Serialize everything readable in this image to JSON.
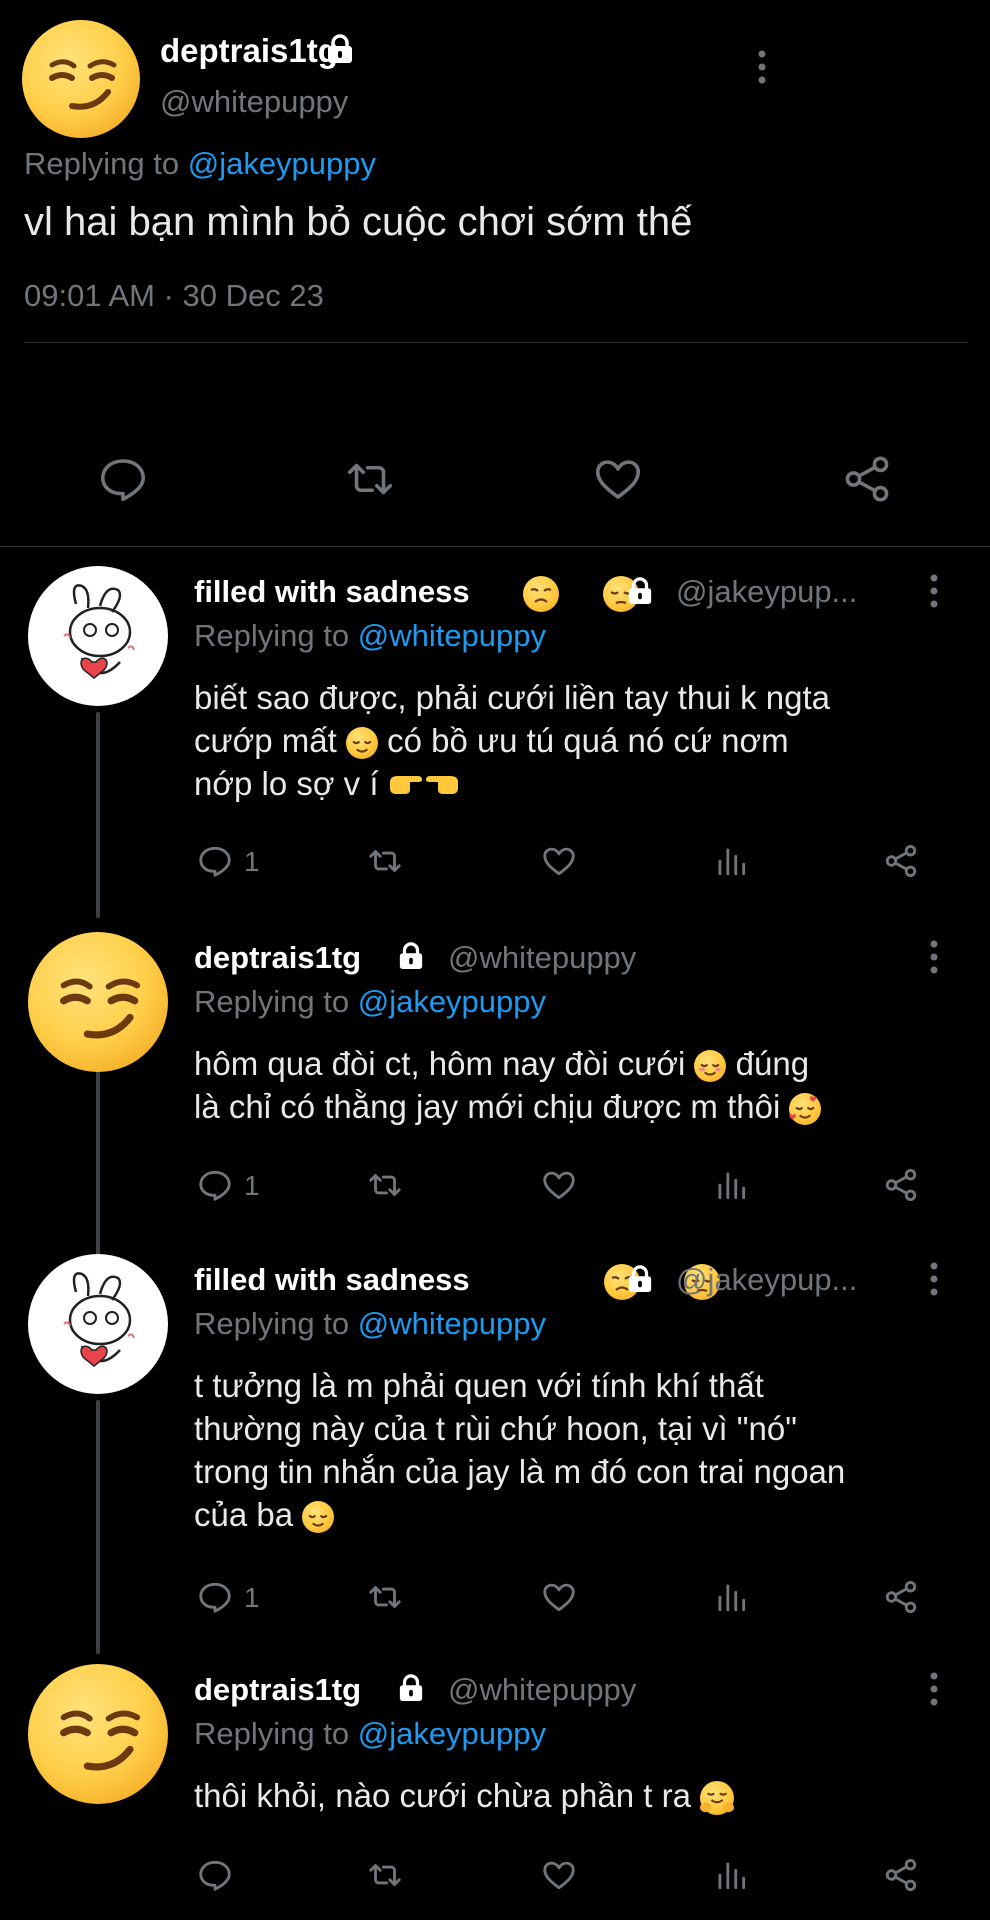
{
  "main_tweet": {
    "display_name": "deptrais1tg",
    "handle": "@whitepuppy",
    "replying_prefix": "Replying to ",
    "replying_to": "@jakeypuppy",
    "text": "vl hai bạn mình bỏ cuộc chơi sớm thế",
    "timestamp": "09:01 AM · 30 Dec 23"
  },
  "replies": [
    {
      "display_name": "filled with sadness",
      "handle": "@jakeypup...",
      "replying_prefix": "Replying to ",
      "replying_to": "@whitepuppy",
      "lines": [
        "biết sao được, phải cưới liền tay thui k ngta",
        "cướp mất",
        "có bồ ưu tú quá nó cứ nơm",
        "nớp lo sợ v í"
      ],
      "reply_count": "1"
    },
    {
      "display_name": "deptrais1tg",
      "handle": "@whitepuppy",
      "replying_prefix": "Replying to ",
      "replying_to": "@jakeypuppy",
      "lines": [
        "hôm qua đòi ct, hôm nay đòi cưới",
        "đúng",
        "là chỉ có thằng jay mới chịu được m thôi"
      ],
      "reply_count": "1"
    },
    {
      "display_name": "filled with sadness",
      "handle": "@jakeypup...",
      "replying_prefix": "Replying to ",
      "replying_to": "@whitepuppy",
      "lines": [
        "t tưởng là m phải quen với tính khí thất",
        "thường này của t rùi chứ hoon, tại vì \"nó\"",
        "trong tin nhắn của jay là m đó con trai ngoan",
        "của ba"
      ],
      "reply_count": "1"
    },
    {
      "display_name": "deptrais1tg",
      "handle": "@whitepuppy",
      "replying_prefix": "Replying to ",
      "replying_to": "@jakeypuppy",
      "lines": [
        "thôi khỏi, nào cưới chừa phần t ra"
      ],
      "reply_count": ""
    }
  ],
  "icons": [
    "lock-icon",
    "more-icon",
    "reply-icon",
    "retweet-icon",
    "like-icon",
    "share-icon",
    "analytics-icon",
    "smirk-emoji",
    "pensive-emoji",
    "disappointed-emoji",
    "relieved-emoji",
    "smiling-emoji",
    "hug-emoji",
    "pointing-hands-emoji",
    "smiling-hearts-emoji"
  ],
  "colors": {
    "background": "#000000",
    "text": "#e7e9ea",
    "muted": "#71767b",
    "link": "#1d9bf0",
    "divider": "#2f3336"
  }
}
